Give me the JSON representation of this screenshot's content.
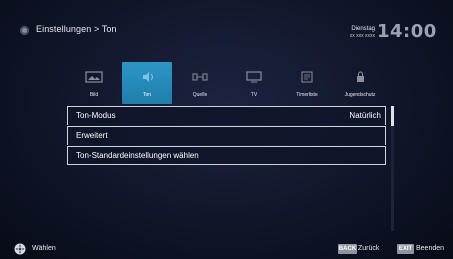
{
  "header": {
    "breadcrumb": "Einstellungen > Ton",
    "day": "Dienstag",
    "date": "xx xxx xxxx",
    "time": "14:00"
  },
  "tabs": [
    {
      "label": "Bild",
      "icon": "picture-icon",
      "active": false
    },
    {
      "label": "Ton",
      "icon": "sound-icon",
      "active": true
    },
    {
      "label": "Quelle",
      "icon": "source-icon",
      "active": false
    },
    {
      "label": "TV",
      "icon": "tv-icon",
      "active": false
    },
    {
      "label": "Timerliste",
      "icon": "timer-list-icon",
      "active": false
    },
    {
      "label": "Jugendschutz",
      "icon": "parental-lock-icon",
      "active": false
    }
  ],
  "menu": [
    {
      "label": "Ton-Modus",
      "value": "Natürlich"
    },
    {
      "label": "Erweitert",
      "value": ""
    },
    {
      "label": "Ton-Standardeinstellungen wählen",
      "value": ""
    }
  ],
  "footer": {
    "select_label": "Wählen",
    "back_key": "BACK",
    "back_label": "Zurück",
    "exit_key": "EXIT",
    "exit_label": "Beenden"
  },
  "colors": {
    "accent": "#2a8fc0",
    "background": "#101629",
    "key_badge": "#8f959f"
  }
}
